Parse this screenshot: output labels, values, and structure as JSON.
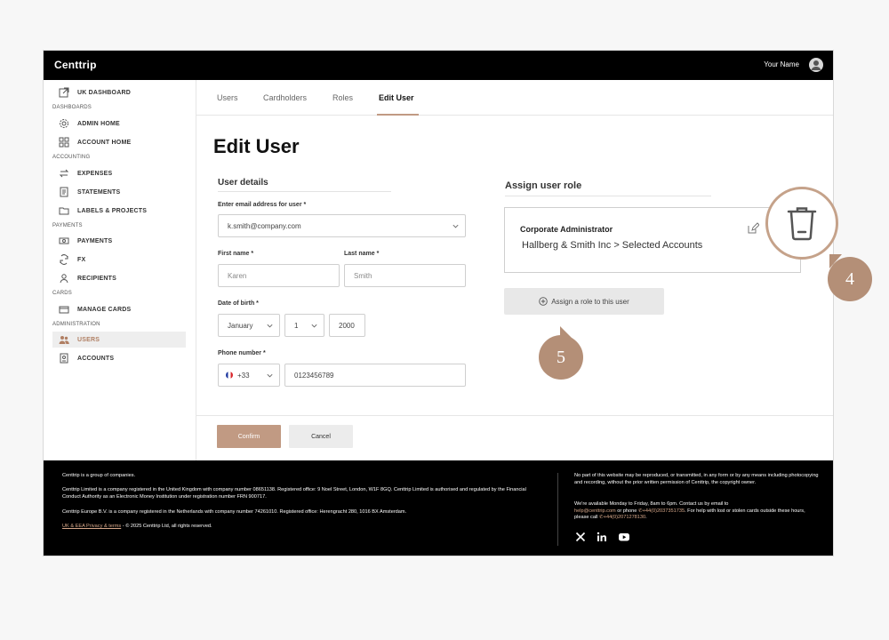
{
  "app": {
    "brand": "Centtrip",
    "user_name": "Your Name"
  },
  "sidebar": {
    "top_item": {
      "label": "UK DASHBOARD",
      "icon": "external-link-icon"
    },
    "sections": [
      {
        "title": "DASHBOARDS",
        "items": [
          {
            "label": "ADMIN HOME",
            "icon": "gear-icon"
          },
          {
            "label": "ACCOUNT HOME",
            "icon": "grid-icon"
          }
        ]
      },
      {
        "title": "ACCOUNTING",
        "items": [
          {
            "label": "EXPENSES",
            "icon": "exchange-icon"
          },
          {
            "label": "STATEMENTS",
            "icon": "document-icon"
          },
          {
            "label": "LABELS & PROJECTS",
            "icon": "folder-icon"
          }
        ]
      },
      {
        "title": "PAYMENTS",
        "items": [
          {
            "label": "PAYMENTS",
            "icon": "banknote-icon"
          },
          {
            "label": "FX",
            "icon": "currency-exchange-icon"
          },
          {
            "label": "RECIPIENTS",
            "icon": "user-icon"
          }
        ]
      },
      {
        "title": "CARDS",
        "items": [
          {
            "label": "MANAGE CARDS",
            "icon": "card-icon"
          }
        ]
      },
      {
        "title": "ADMINISTRATION",
        "items": [
          {
            "label": "USERS",
            "icon": "users-icon",
            "active": true
          },
          {
            "label": "ACCOUNTS",
            "icon": "accounts-icon"
          }
        ]
      }
    ]
  },
  "tabs": [
    {
      "label": "Users"
    },
    {
      "label": "Cardholders"
    },
    {
      "label": "Roles"
    },
    {
      "label": "Edit User",
      "active": true
    }
  ],
  "page": {
    "title": "Edit User"
  },
  "user_details": {
    "heading": "User details",
    "email_label": "Enter email address for user *",
    "email_value": "k.smith@company.com",
    "first_name_label": "First name *",
    "first_name_value": "Karen",
    "last_name_label": "Last name *",
    "last_name_value": "Smith",
    "dob_label": "Date of birth *",
    "dob_month": "January",
    "dob_day": "1",
    "dob_year": "2000",
    "phone_label": "Phone number *",
    "phone_country_code": "+33",
    "phone_value": "0123456789"
  },
  "roles": {
    "heading": "Assign user role",
    "role_name": "Corporate Administrator",
    "role_scope": "Hallberg & Smith Inc > Selected Accounts",
    "assign_label": "Assign a role to this user"
  },
  "actions": {
    "confirm": "Confirm",
    "cancel": "Cancel"
  },
  "footer": {
    "line1": "Centtrip is a group of companies.",
    "line2": "Centtrip Limited is a company registered in the United Kingdom with company number 08651138. Registered office: 9 Noel Street, London, W1F 8GQ. Centtrip Limited is authorised and regulated by the Financial Conduct Authority as an Electronic Money Institution under registration number FRN 900717.",
    "line3": "Centtrip Europe B.V. is a company registered in the Netherlands with company number 74261010. Registered office: Herengracht 280, 1016 BX Amsterdam.",
    "privacy_link": "UK & EEA Privacy & terms",
    "copyright": " - © 2025 Centtrip Ltd, all rights reserved.",
    "right1": "No part of this website may be reproduced, or transmitted, in any form or by any means including photocopying and recording, without the prior written permission of Centtrip, the copyright owner.",
    "right2a": "We're available Monday to Friday, 8am to 6pm. Contact us by email to",
    "email": "help@centtrip.com",
    "right2b": " or phone ",
    "phone1": "+44(0)2037351735",
    "right2c": ". For help with lost or stolen cards outside these hours, please call ",
    "phone2": "+44(0)2071278130",
    "right2d": "."
  },
  "annotations": {
    "delete_callout": "4",
    "assign_callout": "5"
  },
  "colors": {
    "accent": "#c19a83",
    "callout": "#b48f77",
    "topbar": "#000000"
  }
}
